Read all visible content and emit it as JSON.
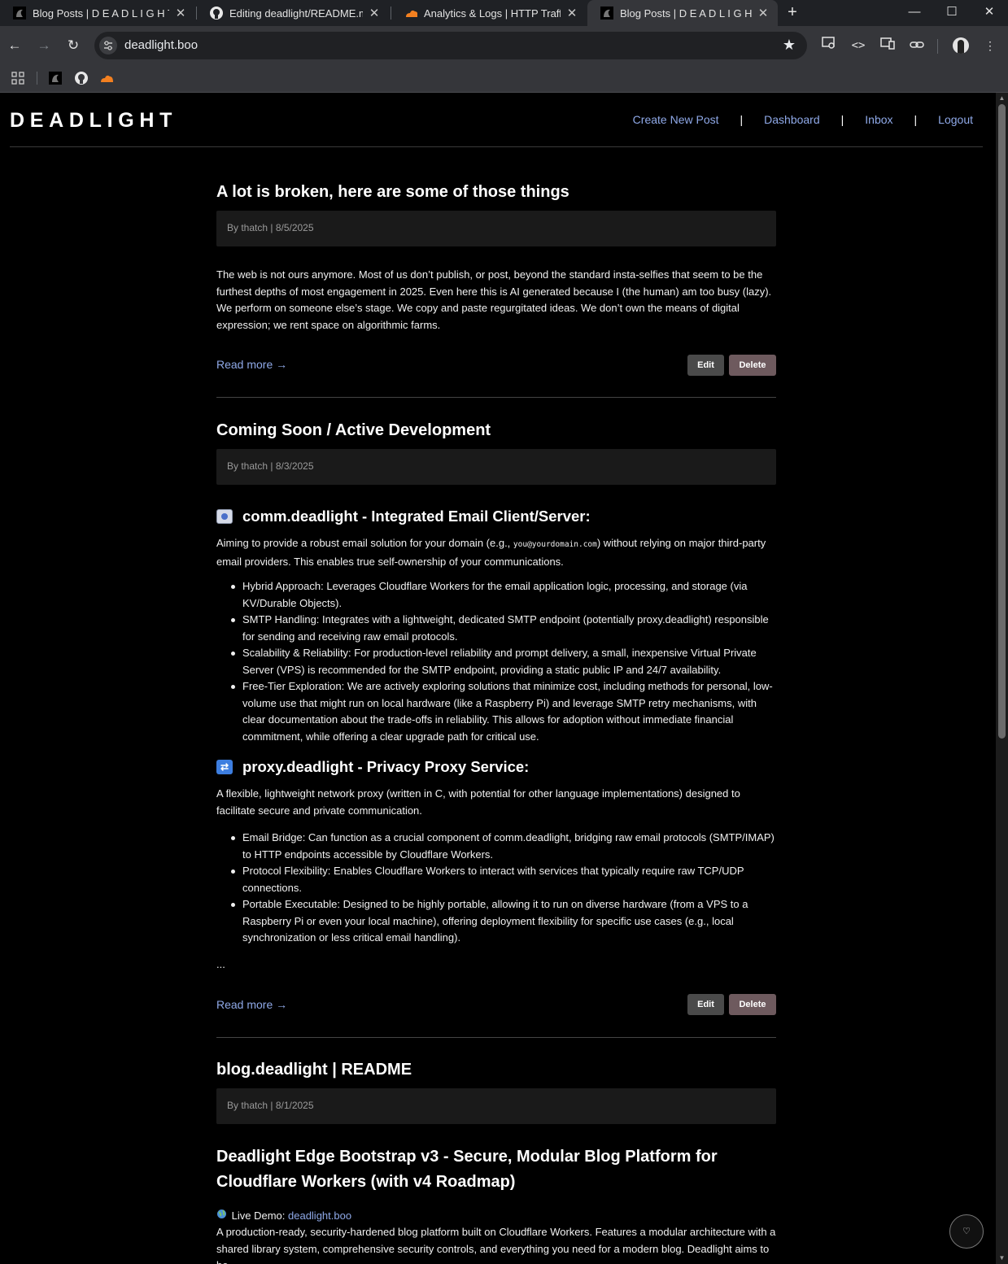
{
  "browser": {
    "tabs": [
      {
        "title": "Blog Posts | D E A D L I G H T",
        "icon": "deadlight-favicon"
      },
      {
        "title": "Editing deadlight/README.md at",
        "icon": "github-favicon"
      },
      {
        "title": "Analytics & Logs | HTTP Traffic |",
        "icon": "cloudflare-favicon"
      },
      {
        "title": "Blog Posts | D E A D L I G H T",
        "icon": "deadlight-favicon"
      }
    ],
    "url": "deadlight.boo",
    "bookmarks": [
      "apps-icon",
      "deadlight-favicon",
      "github-favicon",
      "cloudflare-favicon"
    ]
  },
  "site": {
    "brand": "DEADLIGHT",
    "nav": {
      "create": "Create New Post",
      "dashboard": "Dashboard",
      "inbox": "Inbox",
      "logout": "Logout",
      "separator": "|"
    }
  },
  "posts": [
    {
      "title": "A lot is broken, here are some of those things",
      "meta": "By thatch | 8/5/2025",
      "excerpt": "The web is not ours anymore. Most of us don’t publish, or post, beyond the standard insta-selfies that seem to be the furthest depths of most engagement in 2025. Even here this is AI generated because I (the human) am too busy (lazy). We perform on someone else’s stage. We copy and paste regurgitated ideas. We don’t own the means of digital expression; we rent space on algorithmic farms.",
      "read_more": "Read more →",
      "edit": "Edit",
      "delete": "Delete"
    },
    {
      "title": "Coming Soon / Active Development",
      "meta": "By thatch | 8/3/2025",
      "section1": {
        "heading": "comm.deadlight - Integrated Email Client/Server:",
        "intro_a": "Aiming to provide a robust email solution for your domain (e.g., ",
        "intro_code": "you@yourdomain.com",
        "intro_b": ") without relying on major third-party email providers. This enables true self-ownership of your communications.",
        "items": [
          "Hybrid Approach: Leverages Cloudflare Workers for the email application logic, processing, and storage (via KV/Durable Objects).",
          "SMTP Handling: Integrates with a lightweight, dedicated SMTP endpoint (potentially proxy.deadlight) responsible for sending and receiving raw email protocols.",
          "Scalability & Reliability: For production-level reliability and prompt delivery, a small, inexpensive Virtual Private Server (VPS) is recommended for the SMTP endpoint, providing a static public IP and 24/7 availability.",
          "Free-Tier Exploration: We are actively exploring solutions that minimize cost, including methods for personal, low-volume use that might run on local hardware (like a Raspberry Pi) and leverage SMTP retry mechanisms, with clear documentation about the trade-offs in reliability. This allows for adoption without immediate financial commitment, while offering a clear upgrade path for critical use."
        ]
      },
      "section2": {
        "heading": "proxy.deadlight - Privacy Proxy Service:",
        "intro": "A flexible, lightweight network proxy (written in C, with potential for other language implementations) designed to facilitate secure and private communication.",
        "items": [
          "Email Bridge: Can function as a crucial component of comm.deadlight, bridging raw email protocols (SMTP/IMAP) to HTTP endpoints accessible by Cloudflare Workers.",
          "Protocol Flexibility: Enables Cloudflare Workers to interact with services that typically require raw TCP/UDP connections.",
          "Portable Executable: Designed to be highly portable, allowing it to run on diverse hardware (from a VPS to a Raspberry Pi or even your local machine), offering deployment flexibility for specific use cases (e.g., local synchronization or less critical email handling)."
        ]
      },
      "ellipsis": "...",
      "read_more": "Read more →",
      "edit": "Edit",
      "delete": "Delete"
    },
    {
      "title": "blog.deadlight | README",
      "meta": "By thatch | 8/1/2025",
      "heading": "Deadlight Edge Bootstrap v3 - Secure, Modular Blog Platform for Cloudflare Workers (with v4 Roadmap)",
      "demo_label": "Live Demo: ",
      "demo_link": "deadlight.boo",
      "excerpt": "A production-ready, security-hardened blog platform built on Cloudflare Workers. Features a modular architecture with a shared library system, comprehensive security controls, and everything you need for a modern blog. Deadlight aims to be"
    }
  ],
  "fab_icon": "♡"
}
